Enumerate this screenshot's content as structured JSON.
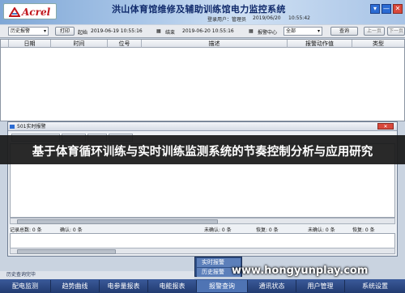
{
  "header": {
    "logo_text": "Acrel",
    "title": "洪山体育馆维修及辅助训练馆电力监控系统",
    "user_label": "登录用户：管理员",
    "date": "2019/06/20",
    "time": "10:55:42",
    "window_buttons": [
      "▾",
      "—",
      "✕"
    ]
  },
  "toolbar": {
    "history_select": "历史报警",
    "print_label": "打印",
    "start_label": "起始",
    "start_value": "2019-06-19  10:55:16",
    "end_label": "结束",
    "end_value": "2019-06-20  10:55:16",
    "alarm_center_label": "报警中心",
    "alarm_center_value": "全部",
    "query_label": "查询",
    "prev_page_label": "上一页",
    "next_page_label": "下一页"
  },
  "alarm_table": {
    "columns": [
      "日期",
      "时间",
      "位号",
      "描述",
      "报警动作值",
      "类型"
    ]
  },
  "rt_window": {
    "title": "501实时报警",
    "close_label": "✕",
    "tabs": [
      "",
      "",
      "",
      ""
    ],
    "stats": {
      "record_total": "记录总数: 0 条",
      "confirmed": "确认: 0 条",
      "unconfirmed": "未确认: 0 条",
      "recovered": "恢复: 0 条",
      "unconfirmed2": "未确认: 0 条",
      "recovered2": "恢复: 0 条"
    }
  },
  "banner": {
    "text": "基于体育循环训练与实时训练监测系统的节奏控制分析与应用研究"
  },
  "popup_menu": {
    "items": [
      "实时报警",
      "历史报警"
    ]
  },
  "status_bar": {
    "text": "历史查询完毕"
  },
  "bottom_nav": {
    "items": [
      "配电监测",
      "趋势曲线",
      "电参量报表",
      "电能报表",
      "报警查询",
      "通讯状态",
      "用户管理",
      "系统设置"
    ]
  },
  "watermark": {
    "text": "www.hongyunplay.com"
  },
  "colors": {
    "header_blue": "#a9c6e8",
    "title_navy": "#102a6b",
    "logo_red": "#c0161c",
    "nav_blue": "#2a467f",
    "banner_dark": "#191919"
  }
}
